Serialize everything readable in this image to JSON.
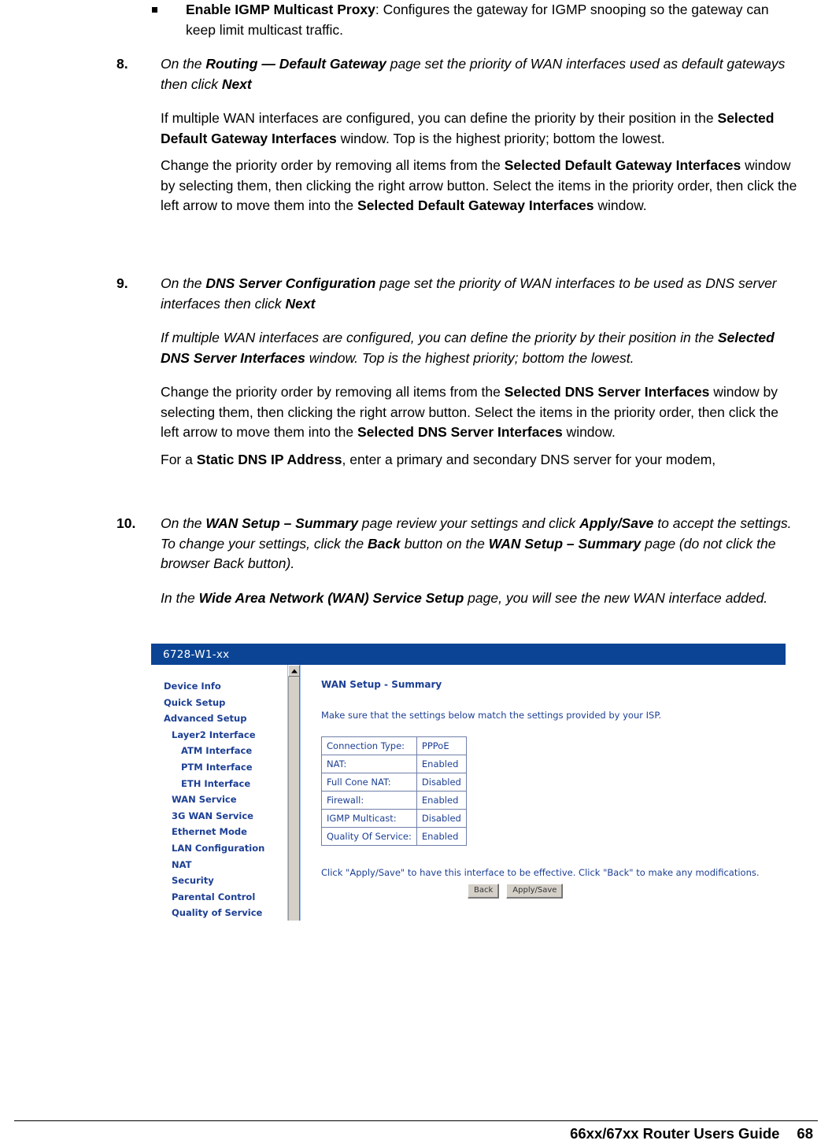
{
  "document": {
    "bullet": {
      "term": "Enable IGMP Multicast Proxy",
      "rest": ": Configures the gateway for IGMP snooping so the gateway can keep limit multicast traffic."
    },
    "steps": [
      {
        "number": "8.",
        "lead_1": "On the ",
        "lead_bold_1": "Routing — Default Gateway",
        "lead_2": " page set the priority of WAN interfaces used as default gateways then click ",
        "lead_bold_2": "Next",
        "paragraphs": [
          {
            "parts": [
              {
                "t": "If multiple WAN interfaces are configured, you can define the priority by their position in the ",
                "b": false
              },
              {
                "t": "Selected Default Gateway Interfaces",
                "b": true
              },
              {
                "t": " window. Top is the highest priority; bottom the lowest.",
                "b": false
              }
            ],
            "italic": false,
            "gap": true
          },
          {
            "parts": [
              {
                "t": "Change the priority order by removing all items from the ",
                "b": false
              },
              {
                "t": "Selected Default Gateway Interfaces",
                "b": true
              },
              {
                "t": " window by selecting them, then clicking the right arrow button. Select the items in the priority order, then click the left arrow to move them into the ",
                "b": false
              },
              {
                "t": "Selected Default Gateway Interfaces",
                "b": true
              },
              {
                "t": " window.",
                "b": false
              }
            ],
            "italic": false,
            "gap": false
          }
        ]
      },
      {
        "number": "9.",
        "lead_1": "On the ",
        "lead_bold_1": "DNS Server Configuration",
        "lead_2": " page set the priority of WAN interfaces to be used as DNS server interfaces then click ",
        "lead_bold_2": "Next",
        "paragraphs": [
          {
            "parts": [
              {
                "t": "If multiple WAN interfaces are configured, you can define the priority by their position in the ",
                "b": false
              },
              {
                "t": "Selected DNS Server Interfaces",
                "b": true
              },
              {
                "t": " window. Top is the highest priority; bottom the lowest.",
                "b": false
              }
            ],
            "italic": true,
            "gap": true
          },
          {
            "parts": [
              {
                "t": "Change the priority order by removing all items from the ",
                "b": false
              },
              {
                "t": "Selected DNS Server Interfaces",
                "b": true
              },
              {
                "t": " window by selecting them, then clicking the right arrow button. Select the items in the priority order, then click the left arrow to move them into the ",
                "b": false
              },
              {
                "t": "Selected DNS Server Interfaces",
                "b": true
              },
              {
                "t": " window.",
                "b": false
              }
            ],
            "italic": false,
            "gap": true
          },
          {
            "parts": [
              {
                "t": "For a ",
                "b": false
              },
              {
                "t": "Static DNS IP Address",
                "b": true
              },
              {
                "t": ", enter a primary and secondary DNS server for your modem,",
                "b": false
              }
            ],
            "italic": false,
            "gap": false
          }
        ]
      },
      {
        "number": "10.",
        "lead_1": "On the ",
        "lead_bold_1": "WAN Setup – Summary",
        "lead_2": " page review your settings and click ",
        "lead_bold_2": "Apply/Save",
        "lead_3": " to accept the settings. To change your settings, click the ",
        "lead_bold_3": "Back",
        "lead_4": " button on the ",
        "lead_bold_4": "WAN Setup – Summary",
        "lead_5": " page (do not click the browser Back button).",
        "paragraphs": [
          {
            "parts": [
              {
                "t": "In the ",
                "b": false
              },
              {
                "t": "Wide Area Network (WAN) Service Setup",
                "b": true
              },
              {
                "t": " page, you will see the new WAN interface added.",
                "b": false
              }
            ],
            "italic": true,
            "gap": true
          }
        ]
      }
    ],
    "footer": {
      "guide": "66xx/67xx Router Users Guide",
      "page_number": "68"
    }
  },
  "screenshot": {
    "title": "6728-W1-xx",
    "titlebar_color": "#0b4494",
    "menu_link_color": "#1c3f94",
    "sidebar": [
      {
        "label": "Device Info",
        "level": 0
      },
      {
        "label": "Quick Setup",
        "level": 0
      },
      {
        "label": "Advanced Setup",
        "level": 0
      },
      {
        "label": "Layer2 Interface",
        "level": 1
      },
      {
        "label": "ATM Interface",
        "level": 2
      },
      {
        "label": "PTM Interface",
        "level": 2
      },
      {
        "label": "ETH Interface",
        "level": 2
      },
      {
        "label": "WAN Service",
        "level": 1
      },
      {
        "label": "3G WAN Service",
        "level": 1
      },
      {
        "label": "Ethernet Mode",
        "level": 1
      },
      {
        "label": "LAN Configuration",
        "level": 1
      },
      {
        "label": "NAT",
        "level": 1
      },
      {
        "label": "Security",
        "level": 1
      },
      {
        "label": "Parental Control",
        "level": 1
      },
      {
        "label": "Quality of Service",
        "level": 1
      }
    ],
    "content": {
      "heading": "WAN Setup - Summary",
      "note": "Make sure that the settings below match the settings provided by your ISP.",
      "summary_rows": [
        {
          "label": "Connection Type:",
          "value": "PPPoE"
        },
        {
          "label": "NAT:",
          "value": "Enabled"
        },
        {
          "label": "Full Cone NAT:",
          "value": "Disabled"
        },
        {
          "label": "Firewall:",
          "value": "Enabled"
        },
        {
          "label": "IGMP Multicast:",
          "value": "Disabled"
        },
        {
          "label": "Quality Of Service:",
          "value": "Enabled"
        }
      ],
      "hint": "Click \"Apply/Save\" to have this interface to be effective. Click \"Back\" to make any modifications.",
      "buttons": [
        {
          "label": "Back"
        },
        {
          "label": "Apply/Save"
        }
      ]
    }
  }
}
